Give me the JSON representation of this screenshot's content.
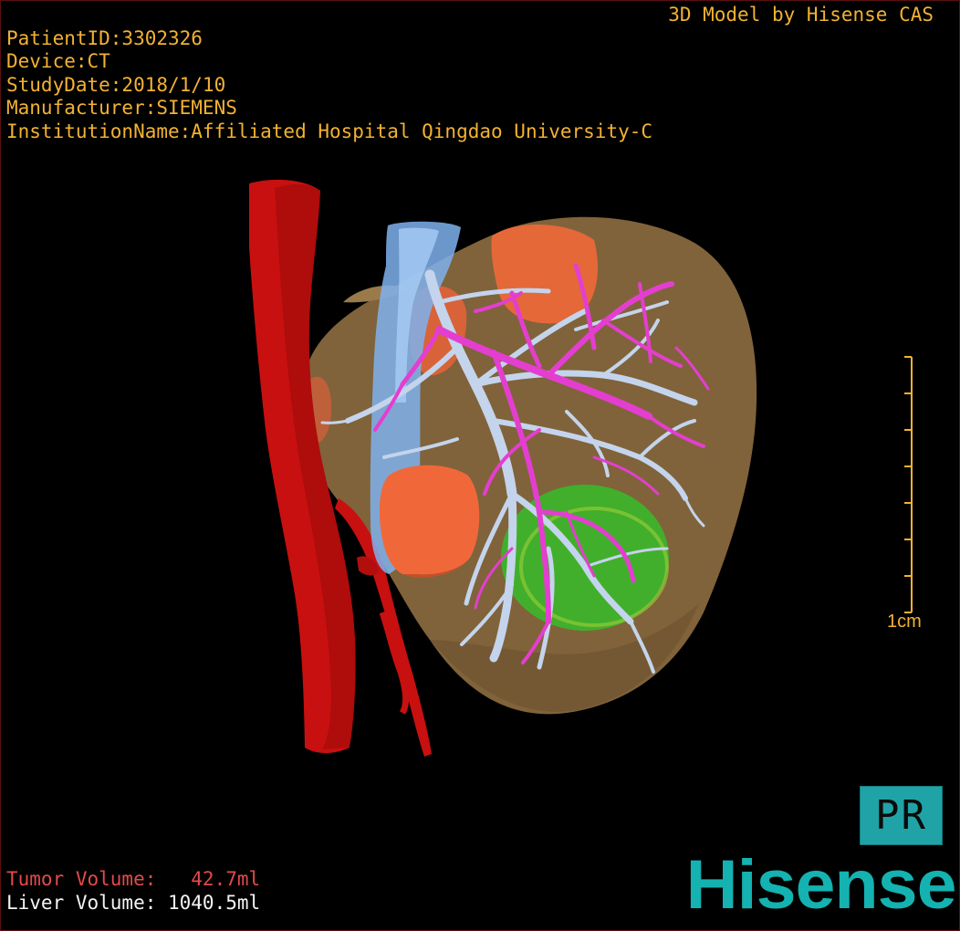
{
  "study_info": {
    "patient_id": "PatientID:3302326",
    "device": "Device:CT",
    "study_date": "StudyDate:2018/1/10",
    "manufacturer": "Manufacturer:SIEMENS",
    "institution": "InstitutionName:Affiliated Hospital Qingdao University-C"
  },
  "credit": "3D Model by Hisense CAS",
  "scale": {
    "label": "1cm"
  },
  "volumes": {
    "tumor": "Tumor Volume:   42.7ml",
    "liver": "Liver Volume: 1040.5ml"
  },
  "badge": {
    "label": "PR"
  },
  "brand": "Hisense",
  "colors": {
    "text": "#f2b233",
    "tumor_text": "#e24a4a",
    "liver": "#8a6a3e",
    "artery": "#c81010",
    "portal_vein": "#c4d4ec",
    "hepatic_vein": "#e43ed0",
    "ivc": "#7fb2ee",
    "tumor_green": "#3cb52a",
    "gallbladder_orange": "#f0683a",
    "brand": "#14b2b0"
  }
}
